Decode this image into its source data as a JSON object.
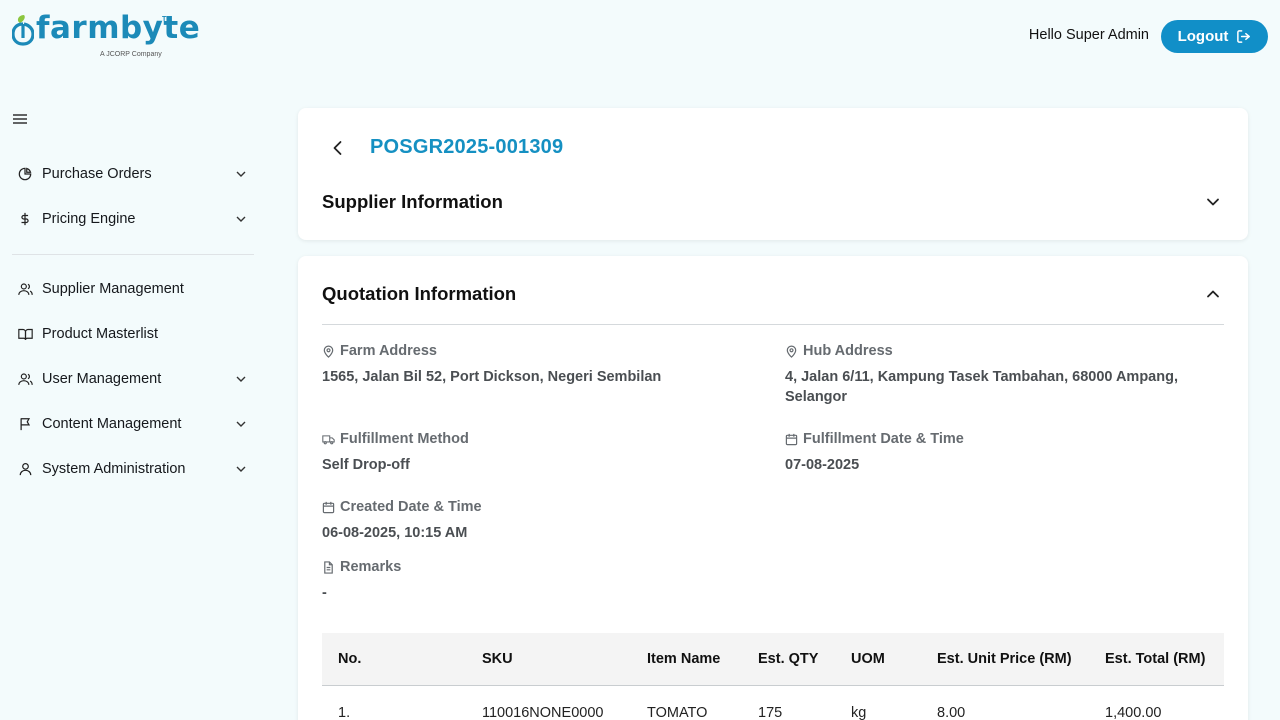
{
  "brand": {
    "name": "farmbyte",
    "tm": "TM",
    "tagline": "A JCORP Company",
    "color": "#1c8ab8"
  },
  "header": {
    "greeting": "Hello Super Admin",
    "logout_label": "Logout",
    "accent": "#118fc8"
  },
  "sidebar": {
    "menu_icon": "hamburger-icon",
    "groups": [
      [
        {
          "label": "Purchase Orders",
          "icon": "pie-chart-icon",
          "expandable": true
        },
        {
          "label": "Pricing Engine",
          "icon": "dollar-icon",
          "expandable": true
        }
      ],
      [
        {
          "label": "Supplier Management",
          "icon": "users-icon",
          "expandable": false
        },
        {
          "label": "Product Masterlist",
          "icon": "book-icon",
          "expandable": false
        },
        {
          "label": "User Management",
          "icon": "users-icon",
          "expandable": true
        },
        {
          "label": "Content Management",
          "icon": "flag-icon",
          "expandable": true
        },
        {
          "label": "System Administration",
          "icon": "user-icon",
          "expandable": true
        }
      ]
    ]
  },
  "order": {
    "id": "POSGR2025-001309"
  },
  "supplier_section": {
    "title": "Supplier Information",
    "expanded": false
  },
  "quotation_section": {
    "title": "Quotation Information",
    "expanded": true,
    "farm_address": {
      "label": "Farm Address",
      "icon": "map-pin-icon",
      "value": "1565, Jalan Bil 52, Port Dickson, Negeri Sembilan"
    },
    "hub_address": {
      "label": "Hub Address",
      "icon": "map-pin-icon",
      "value": "4, Jalan 6/11, Kampung Tasek Tambahan, 68000 Ampang, Selangor"
    },
    "fulfillment_method": {
      "label": "Fulfillment Method",
      "icon": "truck-icon",
      "value": "Self Drop-off"
    },
    "fulfillment_datetime": {
      "label": "Fulfillment Date & Time",
      "icon": "calendar-icon",
      "value": "07-08-2025"
    },
    "created_datetime": {
      "label": "Created Date & Time",
      "icon": "calendar-icon",
      "value": "06-08-2025, 10:15 AM"
    },
    "remarks": {
      "label": "Remarks",
      "icon": "file-icon",
      "value": "-"
    }
  },
  "items_table": {
    "columns": [
      "No.",
      "SKU",
      "Item Name",
      "Est. QTY",
      "UOM",
      "Est. Unit Price (RM)",
      "Est. Total (RM)"
    ],
    "rows": [
      [
        "1.",
        "110016NONE0000",
        "TOMATO",
        "175",
        "kg",
        "8.00",
        "1,400.00"
      ]
    ]
  }
}
